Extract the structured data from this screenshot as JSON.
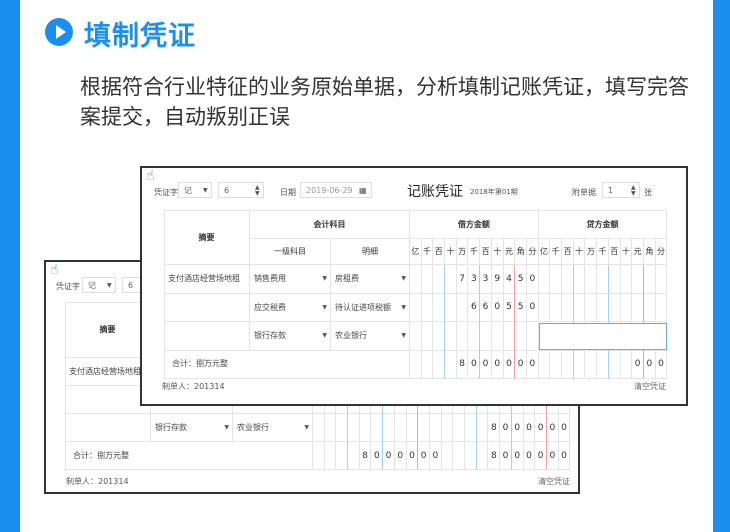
{
  "header": {
    "title": "填制凭证",
    "description": "根据符合行业特征的业务原始单据，分析填制记账凭证，填写完答案提交，自动叛别正误",
    "accent": "#1a8ff0"
  },
  "front": {
    "voucher_word_label": "凭证字",
    "voucher_word": "记",
    "voucher_no": "6",
    "date_label": "日期",
    "date": "2019-06-29",
    "title": "记账凭证",
    "period": "2018年第01期",
    "attach_label": "附单据",
    "attach_count": "1",
    "attach_unit": "张",
    "col_summary": "摘要",
    "col_account": "会计科目",
    "col_debit": "借方金额",
    "col_credit": "贷方金额",
    "col_level1": "一级科目",
    "col_detail": "明细",
    "units": [
      "亿",
      "千",
      "百",
      "十",
      "万",
      "千",
      "百",
      "十",
      "元",
      "角",
      "分"
    ],
    "rows": [
      {
        "summary": "支付酒店经营场地租",
        "account": "销售费用",
        "detail": "房租费",
        "debit": "7339450",
        "credit": ""
      },
      {
        "summary": "",
        "account": "应交税费",
        "detail": "待认证进项税额",
        "debit": "660550",
        "credit": ""
      },
      {
        "summary": "",
        "account": "银行存款",
        "detail": "农业银行",
        "debit": "",
        "credit": "",
        "credit_editing": true
      }
    ],
    "total_label": "合计：捌万元整",
    "total_debit": "8000000",
    "total_credit": "000",
    "maker": "制单人：201314",
    "clear_label": "清空凭证"
  },
  "back": {
    "voucher_word_label": "凭证字",
    "voucher_word": "记",
    "voucher_no": "6",
    "col_summary": "摘要",
    "rows": [
      {
        "summary": "支付酒店经营场地租",
        "account": "",
        "detail": "",
        "debit": "",
        "credit": ""
      },
      {
        "summary": "",
        "account": "",
        "detail": "",
        "debit": "",
        "credit": ""
      },
      {
        "summary": "",
        "account": "银行存款",
        "detail": "农业银行",
        "debit": "",
        "credit": "8000000"
      }
    ],
    "total_label": "合计：捌万元整",
    "total_debit": "8000000",
    "total_credit": "8000000",
    "maker": "制单人：201314",
    "clear_label": "清空凭证"
  }
}
